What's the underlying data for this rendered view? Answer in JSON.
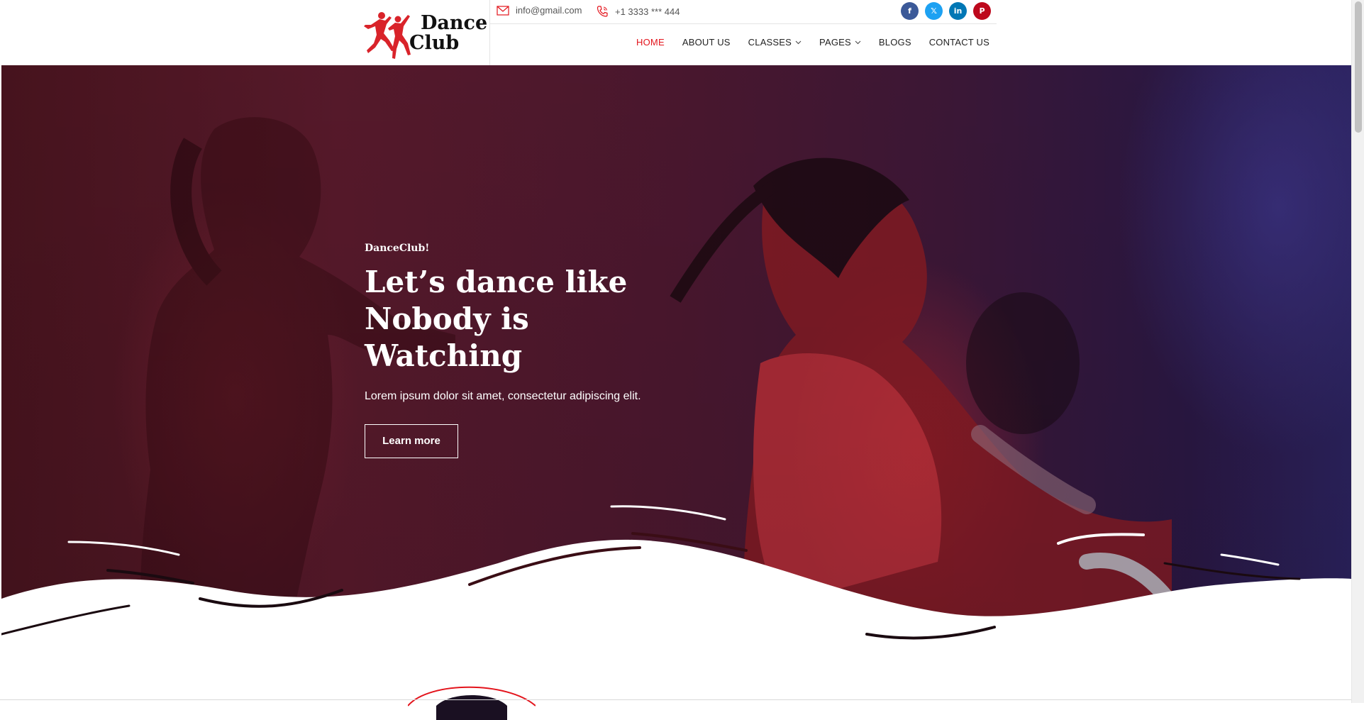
{
  "brand": {
    "logo_line1": "Dance",
    "logo_line2": "Club",
    "accent": "#e3141c"
  },
  "topbar": {
    "email": "info@gmail.com",
    "phone": "+1 3333 *** 444",
    "socials": [
      {
        "name": "facebook",
        "glyph": "f",
        "color": "#3b5998"
      },
      {
        "name": "x",
        "glyph": "𝕏",
        "color": "#1da1f2"
      },
      {
        "name": "linkedin",
        "glyph": "in",
        "color": "#0077b5"
      },
      {
        "name": "pinterest",
        "glyph": "P",
        "color": "#bd081c"
      }
    ]
  },
  "nav": {
    "home": "HOME",
    "about": "ABOUT US",
    "classes": "CLASSES",
    "pages": "PAGES",
    "blogs": "BLOGS",
    "contact": "CONTACT US"
  },
  "hero": {
    "eyebrow": "DanceClub!",
    "headline_1": "Let’s dance like",
    "headline_2": "Nobody is",
    "headline_3": "Watching",
    "lead": "Lorem ipsum dolor sit amet, consectetur adipiscing elit.",
    "cta": "Learn more"
  }
}
